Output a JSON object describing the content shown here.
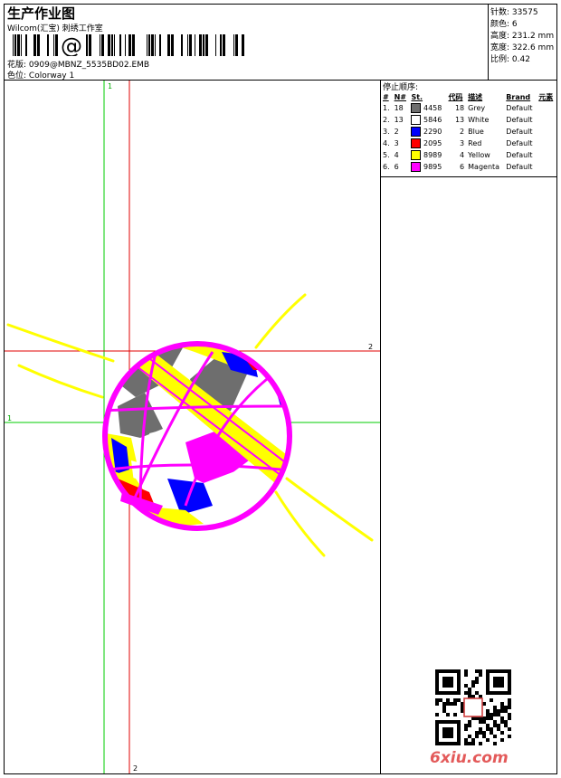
{
  "header": {
    "title": "生产作业图",
    "company": "Wilcom(汇宝) 刺绣工作室",
    "barcode_symbol": "@",
    "design_label": "花版:",
    "design_value": "0909@MBNZ_5535BD02.EMB",
    "colorway_label": "色位:",
    "colorway_value": "Colorway 1"
  },
  "stats": {
    "stitches_label": "针数:",
    "stitches_value": "33575",
    "colors_label": "颜色:",
    "colors_value": "6",
    "height_label": "高度:",
    "height_value": "231.2 mm",
    "width_label": "宽度:",
    "width_value": "322.6 mm",
    "scale_label": "比例:",
    "scale_value": "0.42"
  },
  "stop_sequence": {
    "title": "停止顺序:",
    "columns": [
      "#",
      "N#",
      "St.",
      "代码",
      "描述",
      "Brand",
      "元素"
    ],
    "rows": [
      {
        "idx": "1.",
        "n": "18",
        "color": "#6e6e6e",
        "st": "4458",
        "code": "18",
        "desc": "Grey",
        "brand": "Default"
      },
      {
        "idx": "2.",
        "n": "13",
        "color": "#ffffff",
        "st": "5846",
        "code": "13",
        "desc": "White",
        "brand": "Default"
      },
      {
        "idx": "3.",
        "n": "2",
        "color": "#0000ff",
        "st": "2290",
        "code": "2",
        "desc": "Blue",
        "brand": "Default"
      },
      {
        "idx": "4.",
        "n": "3",
        "color": "#ff0000",
        "st": "2095",
        "code": "3",
        "desc": "Red",
        "brand": "Default"
      },
      {
        "idx": "5.",
        "n": "4",
        "color": "#ffff00",
        "st": "8989",
        "code": "4",
        "desc": "Yellow",
        "brand": "Default"
      },
      {
        "idx": "6.",
        "n": "6",
        "color": "#ff00ff",
        "st": "9895",
        "code": "6",
        "desc": "Magenta",
        "brand": "Default"
      }
    ]
  },
  "guides": {
    "vertical_green_label": "1",
    "vertical_red_label": "2",
    "horizontal_red_label": "2",
    "horizontal_green_label": "1"
  },
  "watermark": {
    "text": "6xiu.com"
  },
  "colors": {
    "grid_green": "#00cc00",
    "grid_red": "#e00000",
    "yellow": "#ffff00",
    "magenta": "#ff00ff"
  }
}
